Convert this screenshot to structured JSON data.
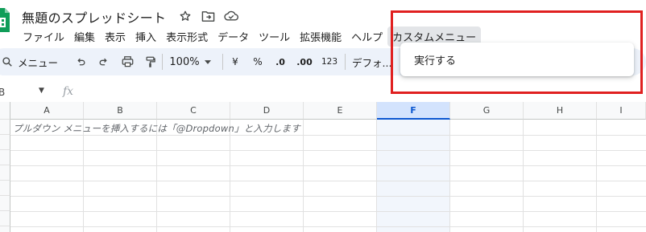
{
  "app": {
    "title": "無題のスプレッドシート"
  },
  "menu": {
    "items": [
      "ファイル",
      "編集",
      "表示",
      "挿入",
      "表示形式",
      "データ",
      "ツール",
      "拡張機能",
      "ヘルプ",
      "カスタムメニュー"
    ],
    "active_index": 9
  },
  "toolbar": {
    "search_label": "メニュー",
    "zoom": "100%",
    "currency": "¥",
    "percent": "%",
    "decimal_decrease": ".0",
    "decimal_increase": ".00",
    "number_format": "123",
    "font": "デフォ..."
  },
  "formula_bar": {
    "cell_ref": "B",
    "fx_label": "fx"
  },
  "sheet": {
    "columns": [
      "A",
      "B",
      "C",
      "D",
      "E",
      "F",
      "G",
      "H",
      "I"
    ],
    "selected_column": "F",
    "hint_text": "プルダウン メニューを挿入するには「@Dropdown」と入力します"
  },
  "custom_menu": {
    "items": [
      "実行する"
    ]
  },
  "colors": {
    "accent": "#0b57d0",
    "highlight_box": "#e02020",
    "sheets_green": "#0f9d58"
  },
  "icons": [
    "sheets-logo-icon",
    "star-icon",
    "move-to-folder-icon",
    "cloud-saved-icon",
    "search-icon",
    "undo-icon",
    "redo-icon",
    "print-icon",
    "paint-format-icon",
    "chevron-down-icon"
  ]
}
